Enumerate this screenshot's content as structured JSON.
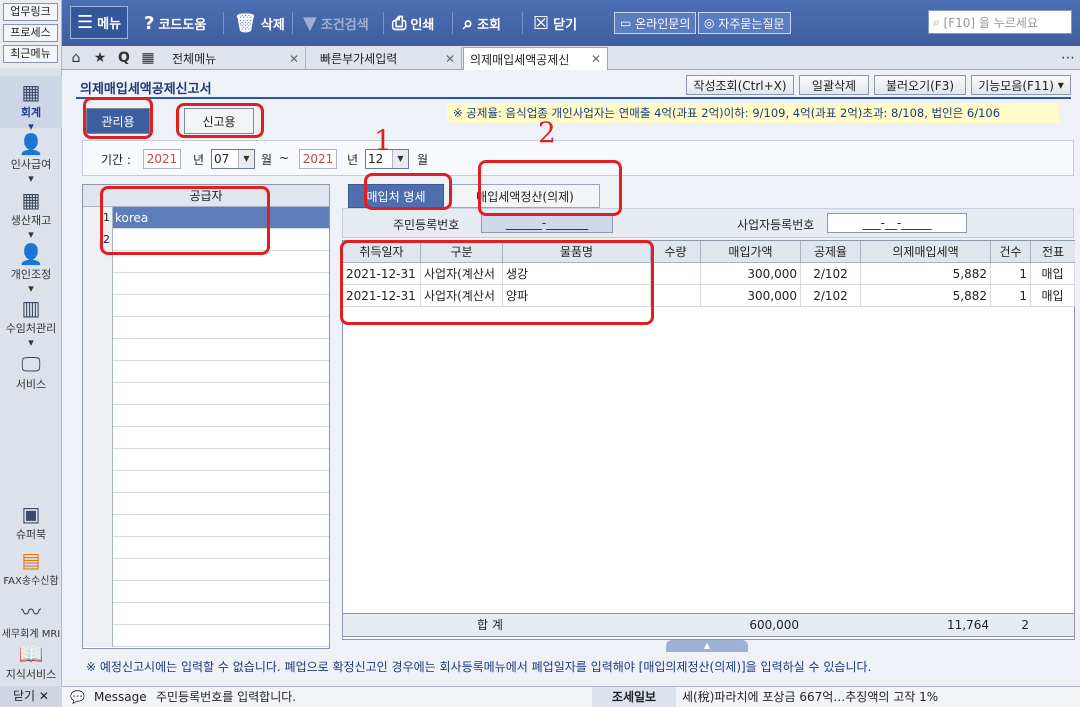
{
  "quick_links": [
    "업무링크",
    "프로세스",
    "최근메뉴"
  ],
  "toolbar": {
    "menu": "메뉴",
    "code_help": "코드도움",
    "delete": "삭제",
    "cond_search": "조건검색",
    "print": "인쇄",
    "lookup": "조회",
    "close": "닫기",
    "online_inquiry": "온라인문의",
    "faq": "자주묻는질문",
    "search_placeholder": "[F10] 을 누르세요"
  },
  "tabs": [
    {
      "label": "전체메뉴"
    },
    {
      "label": "빠른부가세입력"
    },
    {
      "label": "의제매입세액공제신"
    }
  ],
  "leftnav": [
    {
      "label": "회계",
      "icon": "calculator-icon"
    },
    {
      "label": "인사급여",
      "icon": "person-icon"
    },
    {
      "label": "생산재고",
      "icon": "grid-icon"
    },
    {
      "label": "개인조정",
      "icon": "person-icon"
    },
    {
      "label": "수임처관리",
      "icon": "building-icon"
    },
    {
      "label": "서비스",
      "icon": "monitor-icon"
    },
    {
      "label": "슈퍼북",
      "icon": "book-icon"
    },
    {
      "label": "FAX송수신함",
      "icon": "fax-icon"
    },
    {
      "label": "세무회계 MRI",
      "icon": "pulse-icon"
    },
    {
      "label": "지식서비스",
      "icon": "open-book-icon"
    }
  ],
  "close_label": "닫기",
  "page": {
    "title": "의제매입세액공제신고서",
    "buttons": [
      "작성조회(Ctrl+X)",
      "일괄삭제",
      "불러오기(F3)",
      "기능모음(F11)"
    ],
    "mode_tabs": [
      "관리용",
      "신고용"
    ],
    "info": "※ 공제율: 음식업종 개인사업자는 연매출 4억(과표 2억)이하: 9/109, 4억(과표 2억)초과: 8/108, 법인은 6/106",
    "period_label": "기간 :",
    "start_year": "2021",
    "start_month": "07",
    "end_year": "2021",
    "end_month": "12",
    "year_unit": "년",
    "month_unit": "월",
    "tilde": "~",
    "month_end_unit": "월"
  },
  "supplier_grid": {
    "header": "공급자",
    "rows": [
      {
        "num": "1",
        "name": "korea"
      },
      {
        "num": "2",
        "name": ""
      }
    ]
  },
  "detail_tabs": [
    "매입처 명세",
    "매입세액정산(의제)"
  ],
  "detail_head": {
    "resident_label": "주민등록번호",
    "resident_value": "______-_______",
    "biz_label": "사업자등록번호",
    "biz_value": "___-__-_____"
  },
  "detail_grid": {
    "columns": [
      "취득일자",
      "구분",
      "물품명",
      "수량",
      "매입가액",
      "공제율",
      "의제매입세액",
      "건수",
      "전표"
    ],
    "rows": [
      [
        "2021-12-31",
        "사업자(계산서",
        "생강",
        "",
        "300,000",
        "2/102",
        "5,882",
        "1",
        "매입"
      ],
      [
        "2021-12-31",
        "사업자(계산서",
        "양파",
        "",
        "300,000",
        "2/102",
        "5,882",
        "1",
        "매입"
      ]
    ],
    "sum_label": "합      계",
    "sum_amount": "600,000",
    "sum_tax": "11,764",
    "sum_count": "2"
  },
  "note": "※ 예정신고시에는 입력할 수 없습니다. 폐업으로 확정신고인 경우에는 회사등록메뉴에서 폐업일자를 입력해야 [매입의제정산(의제)]을 입력하실 수 있습니다.",
  "status": {
    "message_label": "Message",
    "message": "주민등록번호를 입력합니다.",
    "news_label": "조세일보",
    "news": "세(稅)파라치에 포상금 667억…추징액의 고작 1%"
  },
  "annotations": [
    "1",
    "2"
  ],
  "colors": {
    "annotation": "#e02020",
    "accent": "#2b56a8"
  }
}
